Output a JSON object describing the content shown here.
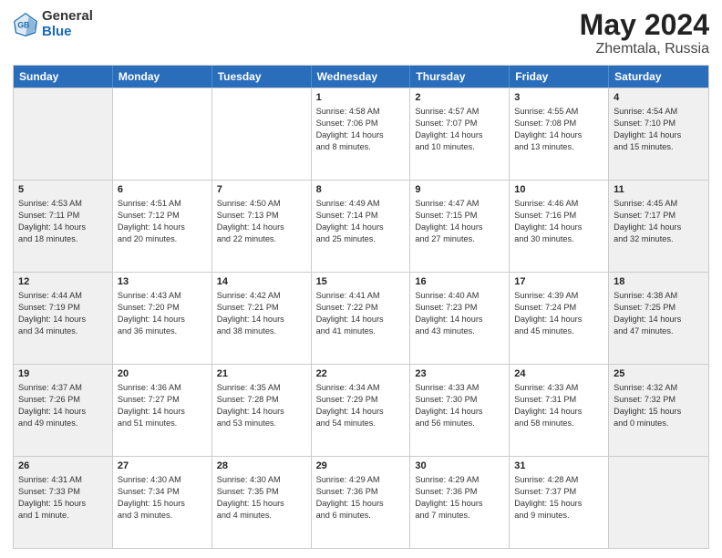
{
  "header": {
    "logo_general": "General",
    "logo_blue": "Blue",
    "title": "May 2024",
    "location": "Zhemtala, Russia"
  },
  "days_of_week": [
    "Sunday",
    "Monday",
    "Tuesday",
    "Wednesday",
    "Thursday",
    "Friday",
    "Saturday"
  ],
  "weeks": [
    [
      {
        "day": "",
        "text": "",
        "shaded": true
      },
      {
        "day": "",
        "text": "",
        "shaded": false
      },
      {
        "day": "",
        "text": "",
        "shaded": false
      },
      {
        "day": "1",
        "text": "Sunrise: 4:58 AM\nSunset: 7:06 PM\nDaylight: 14 hours\nand 8 minutes.",
        "shaded": false
      },
      {
        "day": "2",
        "text": "Sunrise: 4:57 AM\nSunset: 7:07 PM\nDaylight: 14 hours\nand 10 minutes.",
        "shaded": false
      },
      {
        "day": "3",
        "text": "Sunrise: 4:55 AM\nSunset: 7:08 PM\nDaylight: 14 hours\nand 13 minutes.",
        "shaded": false
      },
      {
        "day": "4",
        "text": "Sunrise: 4:54 AM\nSunset: 7:10 PM\nDaylight: 14 hours\nand 15 minutes.",
        "shaded": true
      }
    ],
    [
      {
        "day": "5",
        "text": "Sunrise: 4:53 AM\nSunset: 7:11 PM\nDaylight: 14 hours\nand 18 minutes.",
        "shaded": true
      },
      {
        "day": "6",
        "text": "Sunrise: 4:51 AM\nSunset: 7:12 PM\nDaylight: 14 hours\nand 20 minutes.",
        "shaded": false
      },
      {
        "day": "7",
        "text": "Sunrise: 4:50 AM\nSunset: 7:13 PM\nDaylight: 14 hours\nand 22 minutes.",
        "shaded": false
      },
      {
        "day": "8",
        "text": "Sunrise: 4:49 AM\nSunset: 7:14 PM\nDaylight: 14 hours\nand 25 minutes.",
        "shaded": false
      },
      {
        "day": "9",
        "text": "Sunrise: 4:47 AM\nSunset: 7:15 PM\nDaylight: 14 hours\nand 27 minutes.",
        "shaded": false
      },
      {
        "day": "10",
        "text": "Sunrise: 4:46 AM\nSunset: 7:16 PM\nDaylight: 14 hours\nand 30 minutes.",
        "shaded": false
      },
      {
        "day": "11",
        "text": "Sunrise: 4:45 AM\nSunset: 7:17 PM\nDaylight: 14 hours\nand 32 minutes.",
        "shaded": true
      }
    ],
    [
      {
        "day": "12",
        "text": "Sunrise: 4:44 AM\nSunset: 7:19 PM\nDaylight: 14 hours\nand 34 minutes.",
        "shaded": true
      },
      {
        "day": "13",
        "text": "Sunrise: 4:43 AM\nSunset: 7:20 PM\nDaylight: 14 hours\nand 36 minutes.",
        "shaded": false
      },
      {
        "day": "14",
        "text": "Sunrise: 4:42 AM\nSunset: 7:21 PM\nDaylight: 14 hours\nand 38 minutes.",
        "shaded": false
      },
      {
        "day": "15",
        "text": "Sunrise: 4:41 AM\nSunset: 7:22 PM\nDaylight: 14 hours\nand 41 minutes.",
        "shaded": false
      },
      {
        "day": "16",
        "text": "Sunrise: 4:40 AM\nSunset: 7:23 PM\nDaylight: 14 hours\nand 43 minutes.",
        "shaded": false
      },
      {
        "day": "17",
        "text": "Sunrise: 4:39 AM\nSunset: 7:24 PM\nDaylight: 14 hours\nand 45 minutes.",
        "shaded": false
      },
      {
        "day": "18",
        "text": "Sunrise: 4:38 AM\nSunset: 7:25 PM\nDaylight: 14 hours\nand 47 minutes.",
        "shaded": true
      }
    ],
    [
      {
        "day": "19",
        "text": "Sunrise: 4:37 AM\nSunset: 7:26 PM\nDaylight: 14 hours\nand 49 minutes.",
        "shaded": true
      },
      {
        "day": "20",
        "text": "Sunrise: 4:36 AM\nSunset: 7:27 PM\nDaylight: 14 hours\nand 51 minutes.",
        "shaded": false
      },
      {
        "day": "21",
        "text": "Sunrise: 4:35 AM\nSunset: 7:28 PM\nDaylight: 14 hours\nand 53 minutes.",
        "shaded": false
      },
      {
        "day": "22",
        "text": "Sunrise: 4:34 AM\nSunset: 7:29 PM\nDaylight: 14 hours\nand 54 minutes.",
        "shaded": false
      },
      {
        "day": "23",
        "text": "Sunrise: 4:33 AM\nSunset: 7:30 PM\nDaylight: 14 hours\nand 56 minutes.",
        "shaded": false
      },
      {
        "day": "24",
        "text": "Sunrise: 4:33 AM\nSunset: 7:31 PM\nDaylight: 14 hours\nand 58 minutes.",
        "shaded": false
      },
      {
        "day": "25",
        "text": "Sunrise: 4:32 AM\nSunset: 7:32 PM\nDaylight: 15 hours\nand 0 minutes.",
        "shaded": true
      }
    ],
    [
      {
        "day": "26",
        "text": "Sunrise: 4:31 AM\nSunset: 7:33 PM\nDaylight: 15 hours\nand 1 minute.",
        "shaded": true
      },
      {
        "day": "27",
        "text": "Sunrise: 4:30 AM\nSunset: 7:34 PM\nDaylight: 15 hours\nand 3 minutes.",
        "shaded": false
      },
      {
        "day": "28",
        "text": "Sunrise: 4:30 AM\nSunset: 7:35 PM\nDaylight: 15 hours\nand 4 minutes.",
        "shaded": false
      },
      {
        "day": "29",
        "text": "Sunrise: 4:29 AM\nSunset: 7:36 PM\nDaylight: 15 hours\nand 6 minutes.",
        "shaded": false
      },
      {
        "day": "30",
        "text": "Sunrise: 4:29 AM\nSunset: 7:36 PM\nDaylight: 15 hours\nand 7 minutes.",
        "shaded": false
      },
      {
        "day": "31",
        "text": "Sunrise: 4:28 AM\nSunset: 7:37 PM\nDaylight: 15 hours\nand 9 minutes.",
        "shaded": false
      },
      {
        "day": "",
        "text": "",
        "shaded": true
      }
    ]
  ]
}
